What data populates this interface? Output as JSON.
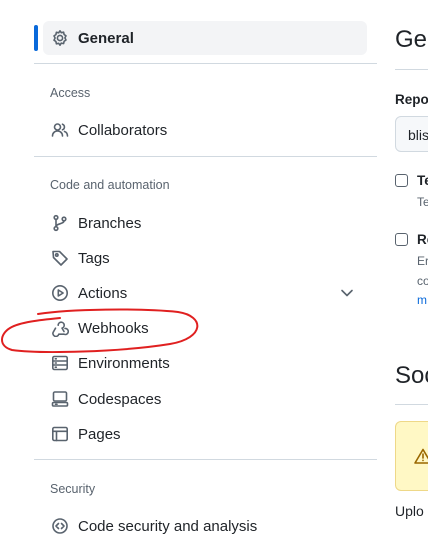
{
  "sidebar": {
    "general": "General",
    "access_title": "Access",
    "collaborators": "Collaborators",
    "code_title": "Code and automation",
    "branches": "Branches",
    "tags": "Tags",
    "actions": "Actions",
    "webhooks": "Webhooks",
    "environments": "Environments",
    "codespaces": "Codespaces",
    "pages": "Pages",
    "security_title": "Security",
    "code_security": "Code security and analysis"
  },
  "main": {
    "heading": "Ge",
    "repo_label": "Repo",
    "repo_value": "blis",
    "checkbox1_label": "Te",
    "checkbox1_desc": "Te",
    "checkbox2_label": "Re",
    "checkbox2_desc1": "Er",
    "checkbox2_desc2": "co",
    "checkbox2_link": "m",
    "social_heading": "Soc",
    "bottom_text": "Uplo"
  },
  "colors": {
    "accent": "#0969da",
    "annotation": "#e02020",
    "warning_bg": "#fff8c5"
  }
}
